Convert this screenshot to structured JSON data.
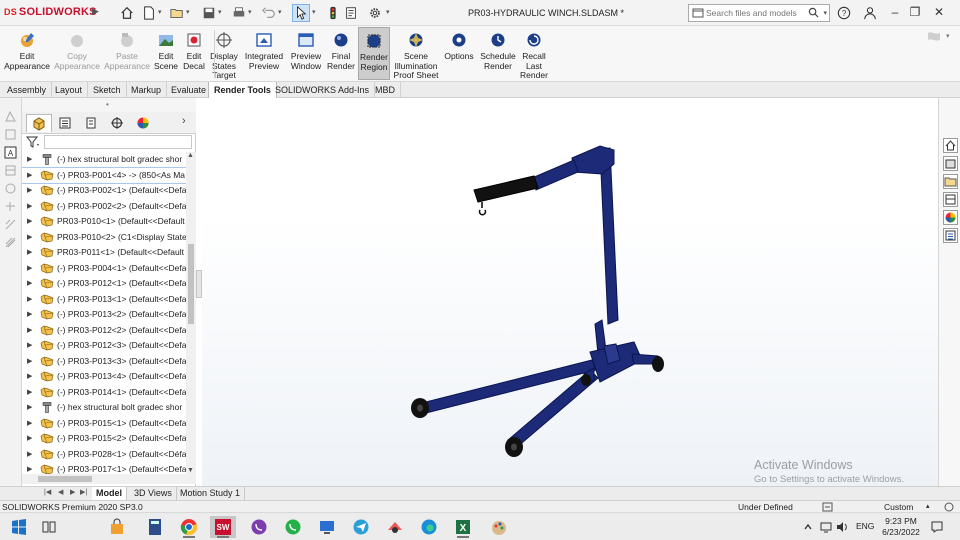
{
  "app": {
    "logo_text": "SOLIDWORKS",
    "logo_prefix": "DS",
    "document_title": "PR03-HYDRAULIC WINCH.SLDASM *"
  },
  "search": {
    "placeholder": "Search files and models"
  },
  "ribbon": {
    "buttons": [
      {
        "label": "Edit\nAppearance",
        "icon": "sphere-palette-icon",
        "enabled": true
      },
      {
        "label": "Copy\nAppearance",
        "icon": "copy-appearance-icon",
        "enabled": false
      },
      {
        "label": "Paste\nAppearance",
        "icon": "paste-appearance-icon",
        "enabled": false
      },
      {
        "label": "Edit\nScene",
        "icon": "scene-icon",
        "enabled": true
      },
      {
        "label": "Edit\nDecal",
        "icon": "decal-icon",
        "enabled": true
      },
      {
        "label": "Display\nStates\nTarget",
        "icon": "display-states-icon",
        "enabled": true
      },
      {
        "label": "Integrated\nPreview",
        "icon": "integrated-preview-icon",
        "enabled": true
      },
      {
        "label": "Preview\nWindow",
        "icon": "preview-window-icon",
        "enabled": true
      },
      {
        "label": "Final\nRender",
        "icon": "final-render-icon",
        "enabled": true
      },
      {
        "label": "Render\nRegion",
        "icon": "render-region-icon",
        "enabled": true,
        "pressed": true
      },
      {
        "label": "Scene\nIllumination\nProof Sheet",
        "icon": "illumination-icon",
        "enabled": true
      },
      {
        "label": "Options",
        "icon": "options-icon",
        "enabled": true
      },
      {
        "label": "Schedule\nRender",
        "icon": "schedule-icon",
        "enabled": true
      },
      {
        "label": "Recall\nLast\nRender",
        "icon": "recall-icon",
        "enabled": true
      }
    ]
  },
  "tabs": [
    "Assembly",
    "Layout",
    "Sketch",
    "Markup",
    "Evaluate",
    "Render Tools",
    "SOLIDWORKS Add-Ins",
    "MBD"
  ],
  "active_tab": "Render Tools",
  "tree": {
    "items": [
      {
        "label": "(-) hex structural bolt gradec shor",
        "type": "bolt"
      },
      {
        "label": "(-) PR03-P001<4> -> (850<As Ma",
        "type": "part"
      },
      {
        "label": "(-) PR03-P002<1> (Default<<Defa",
        "type": "part"
      },
      {
        "label": "(-) PR03-P002<2> (Default<<Defa",
        "type": "part"
      },
      {
        "label": "PR03-P010<1> (Default<<Default",
        "type": "part"
      },
      {
        "label": "PR03-P010<2> (C1<Display State-",
        "type": "part"
      },
      {
        "label": "PR03-P011<1> (Default<<Default",
        "type": "part"
      },
      {
        "label": "(-) PR03-P004<1> (Default<<Defa",
        "type": "part"
      },
      {
        "label": "(-) PR03-P012<1> (Default<<Defa",
        "type": "part"
      },
      {
        "label": "(-) PR03-P013<1> (Default<<Defa",
        "type": "part"
      },
      {
        "label": "(-) PR03-P013<2> (Default<<Defa",
        "type": "part"
      },
      {
        "label": "(-) PR03-P012<2> (Default<<Defa",
        "type": "part"
      },
      {
        "label": "(-) PR03-P012<3> (Default<<Defa",
        "type": "part"
      },
      {
        "label": "(-) PR03-P013<3> (Default<<Defa",
        "type": "part"
      },
      {
        "label": "(-) PR03-P013<4> (Default<<Defa",
        "type": "part"
      },
      {
        "label": "(-) PR03-P014<1> (Default<<Defa",
        "type": "part"
      },
      {
        "label": "(-) hex structural bolt gradec shor",
        "type": "bolt"
      },
      {
        "label": "(-) PR03-P015<1> (Default<<Defa",
        "type": "part"
      },
      {
        "label": "(-) PR03-P015<2> (Default<<Defa",
        "type": "part"
      },
      {
        "label": "(-) PR03-P028<1> (Default<<Défa",
        "type": "part"
      },
      {
        "label": "(-) PR03-P017<1> (Default<<Defa",
        "type": "part"
      }
    ],
    "selected_index": 1
  },
  "bottom_tabs": [
    "Model",
    "3D Views",
    "Motion Study 1"
  ],
  "active_bottom_tab": "Model",
  "status": {
    "version": "SOLIDWORKS Premium 2020 SP3.0",
    "definition": "Under Defined",
    "units": "Custom"
  },
  "watermark": {
    "line1": "Activate Windows",
    "line2": "Go to Settings to activate Windows."
  },
  "taskbar": {
    "language": "ENG",
    "time": "9:23 PM",
    "date": "6/23/2022"
  },
  "colors": {
    "model_blue": "#1c2a78",
    "model_black": "#111111",
    "accent": "#c8102e"
  }
}
